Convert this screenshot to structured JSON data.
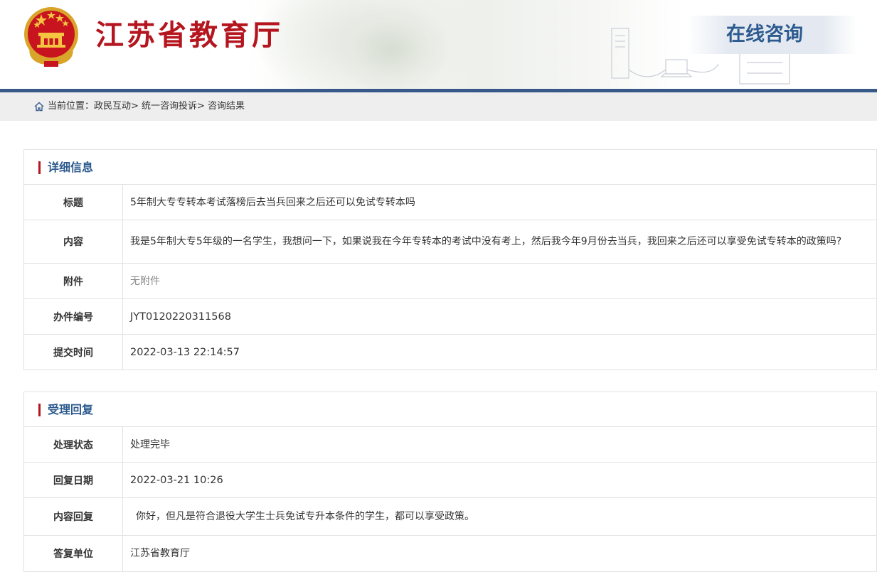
{
  "header": {
    "site_title": "江苏省教育厅",
    "page_badge": "在线咨询",
    "accent_color": "#b4151f",
    "brand_blue": "#36598a"
  },
  "breadcrumb": {
    "icon": "home-icon",
    "text": "当前位置：政民互动> 统一咨询投诉> 咨询结果"
  },
  "details": {
    "title": "详细信息",
    "rows": [
      {
        "label": "标题",
        "value": "5年制大专专转本考试落榜后去当兵回来之后还可以免试专转本吗"
      },
      {
        "label": "内容",
        "value": "我是5年制大专5年级的一名学生，我想问一下，如果说我在今年专转本的考试中没有考上，然后我今年9月份去当兵，我回来之后还可以享受免试专转本的政策吗?"
      },
      {
        "label": "附件",
        "value": "无附件"
      },
      {
        "label": "办件编号",
        "value": "JYT0120220311568"
      },
      {
        "label": "提交时间",
        "value": "2022-03-13 22:14:57"
      }
    ]
  },
  "reply": {
    "title": "受理回复",
    "rows": [
      {
        "label": "处理状态",
        "value": "处理完毕"
      },
      {
        "label": "回复日期",
        "value": "2022-03-21 10:26"
      },
      {
        "label": "内容回复",
        "value": "你好，但凡是符合退役大学生士兵免试专升本条件的学生，都可以享受政策。"
      },
      {
        "label": "答复单位",
        "value": "江苏省教育厅"
      }
    ]
  }
}
